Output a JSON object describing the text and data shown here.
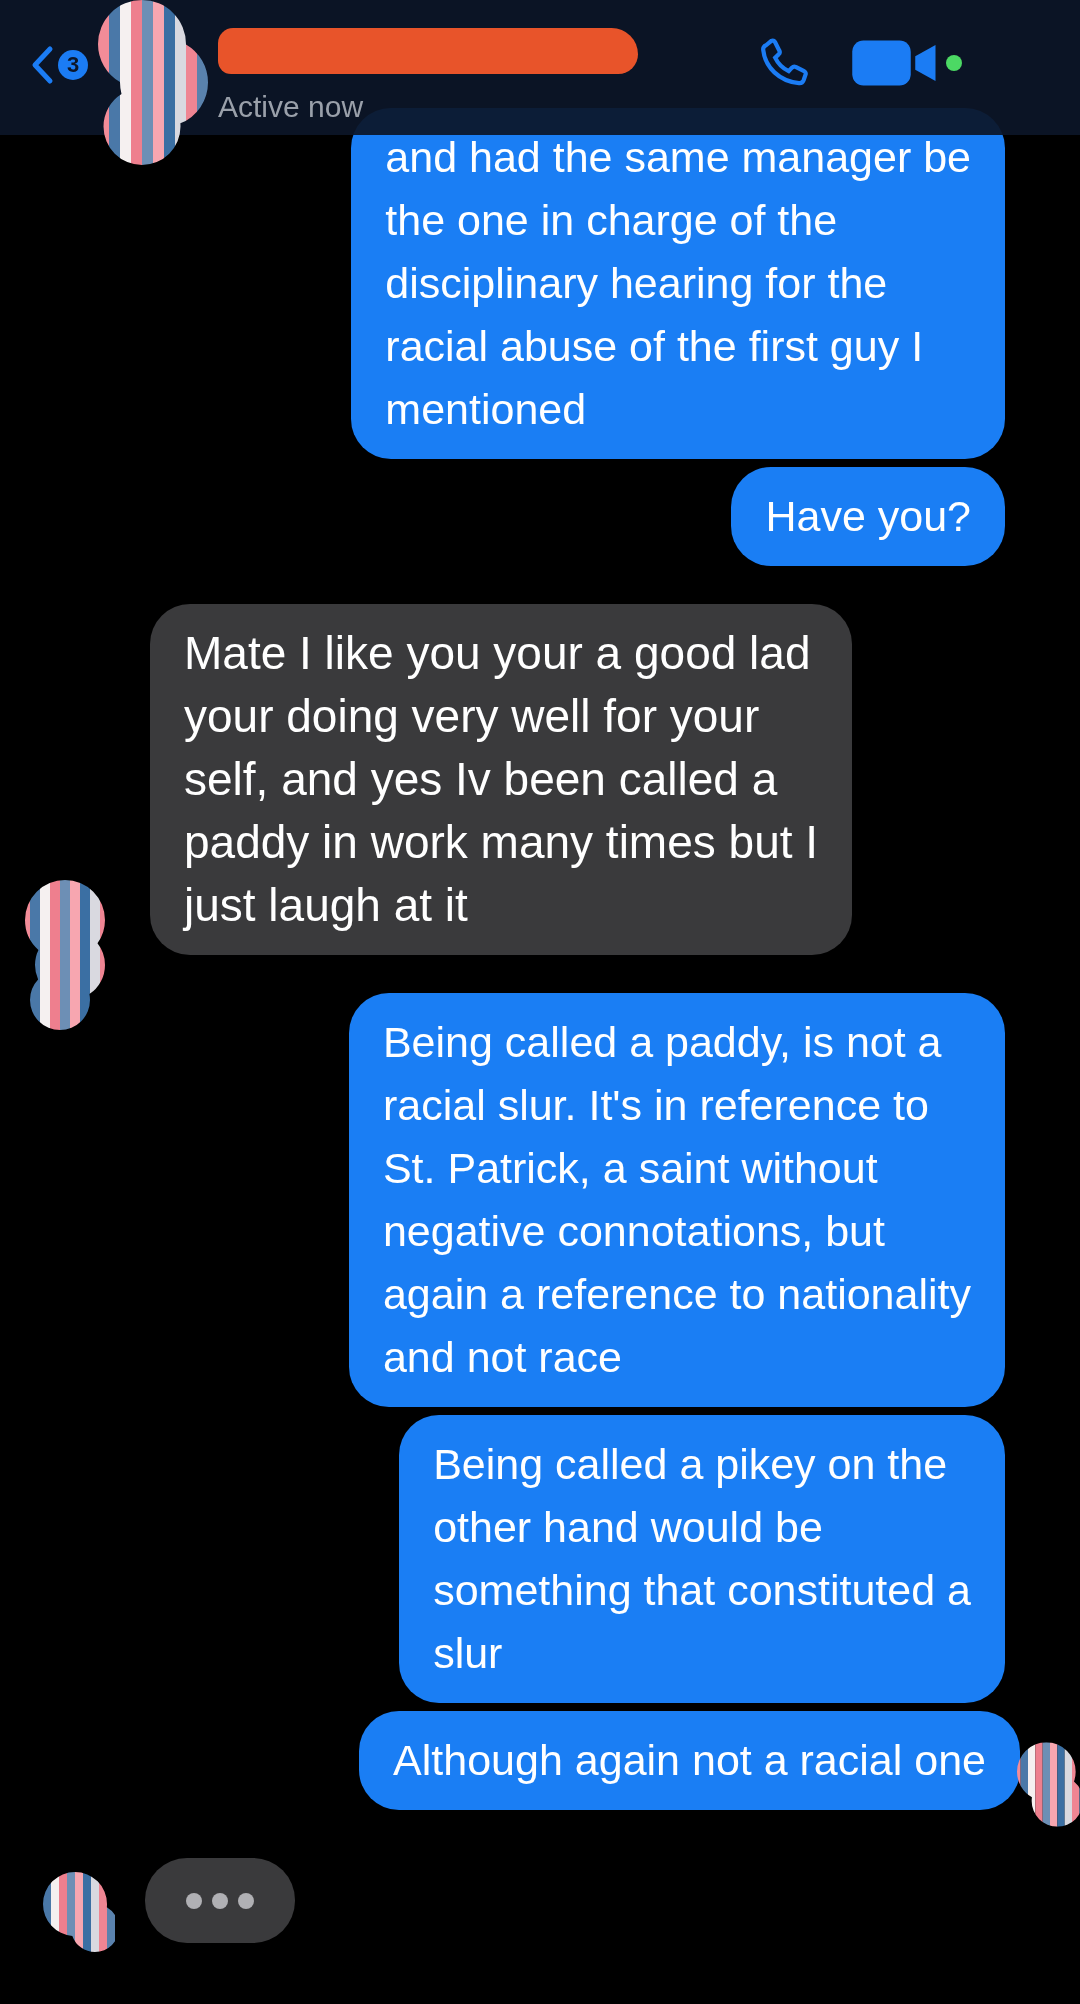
{
  "header": {
    "unread_count": "3",
    "status": "Active now",
    "active": true
  },
  "messages": [
    {
      "kind": "text",
      "outgoing": true,
      "lines": [
        "and had the same manager be",
        "the one in charge of the",
        "disciplinary hearing for the",
        "racial abuse of the first guy I",
        "mentioned"
      ]
    },
    {
      "kind": "text",
      "outgoing": true,
      "lines": [
        "Have you?"
      ]
    },
    {
      "kind": "text",
      "outgoing": false,
      "lines": [
        "Mate I like you your a good lad",
        "your doing very well for your",
        "self, and yes Iv been called a",
        "paddy in work many times but I",
        "just laugh at it"
      ]
    },
    {
      "kind": "text",
      "outgoing": true,
      "lines": [
        "Being called a paddy, is not a",
        "racial slur. It's in reference to",
        "St. Patrick, a saint without",
        "negative connotations, but",
        "again a reference to nationality",
        "and not race"
      ]
    },
    {
      "kind": "text",
      "outgoing": true,
      "lines": [
        "Being called a pikey on the",
        "other hand would be",
        "something that constituted a",
        "slur"
      ]
    },
    {
      "kind": "text",
      "outgoing": true,
      "lines": [
        "Although again not a racial one"
      ],
      "seen": true
    },
    {
      "kind": "typing"
    }
  ]
}
